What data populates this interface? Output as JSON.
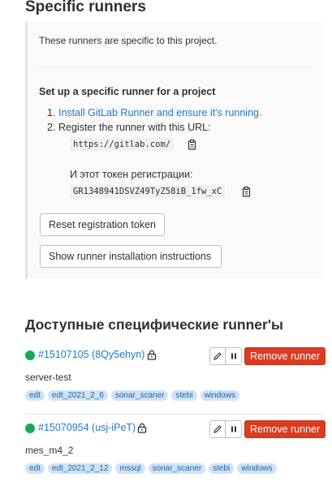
{
  "specific": {
    "title": "Specific runners",
    "intro": "These runners are specific to this project.",
    "setup_title": "Set up a specific runner for a project",
    "steps": [
      {
        "num": "1.",
        "text": "Install GitLab Runner and ensure it's running."
      },
      {
        "num": "2.",
        "text": "Register the runner with this URL:"
      }
    ],
    "url": "https://gitlab.com/",
    "token_label": "И этот токен регистрации:",
    "token": "GR1348941DSVZ49TyZ58iB_1fw_xC",
    "reset_button": "Reset registration token",
    "show_button": "Show runner installation instructions"
  },
  "available": {
    "title": "Доступные специфические runner'ы",
    "runners": [
      {
        "id": "#15107105 (8Qy5ehyn)",
        "description": "server-test",
        "status_color": "#1aaa55",
        "remove_label": "Remove runner",
        "tags": [
          "edt",
          "edt_2021_2_6",
          "sonar_scaner",
          "stebi",
          "windows"
        ]
      },
      {
        "id": "#15070954 (usj-iPeT)",
        "description": "mes_m4_2",
        "status_color": "#1aaa55",
        "remove_label": "Remove runner",
        "tags": [
          "edt",
          "edt_2021_2_12",
          "mssql",
          "sonar_scaner",
          "stebi",
          "windows"
        ]
      }
    ]
  },
  "colors": {
    "link": "#1f78d1",
    "danger": "#db3b21",
    "online": "#1aaa55",
    "tag_bg": "#cfe3f6"
  }
}
